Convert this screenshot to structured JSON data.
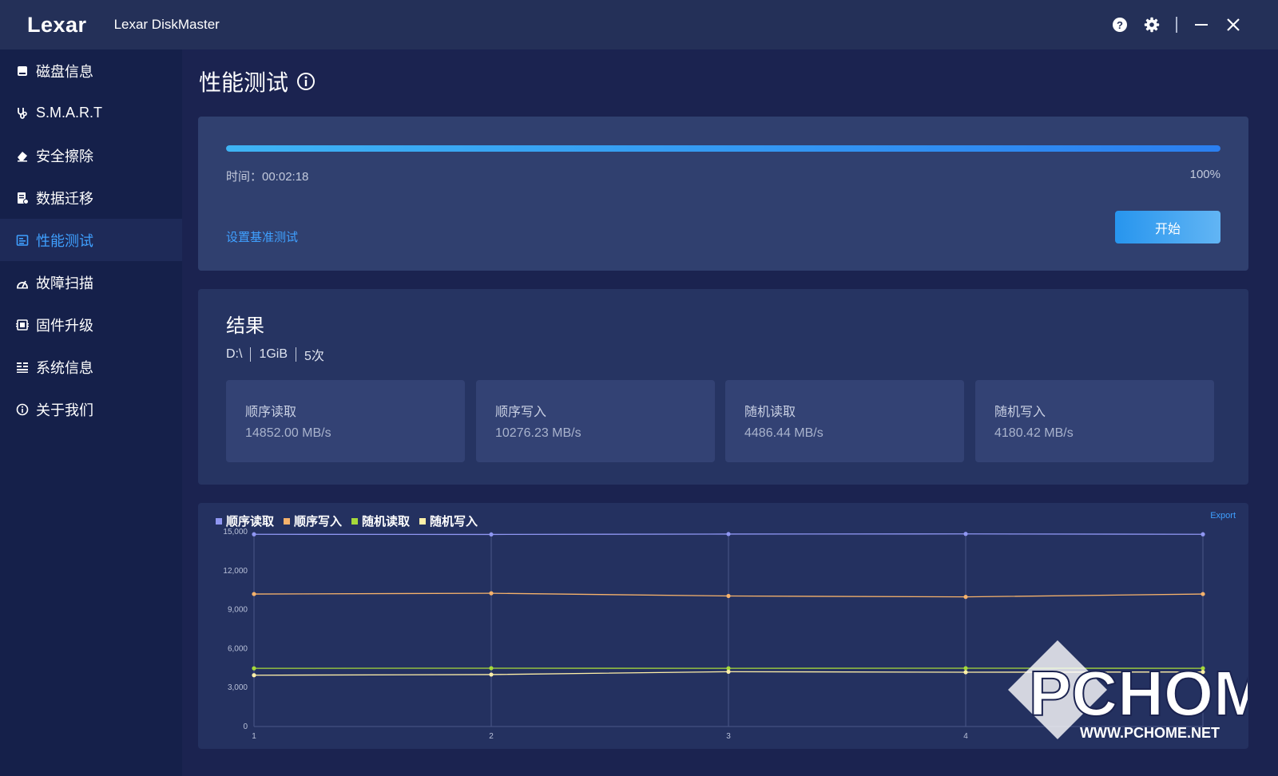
{
  "app": {
    "logo": "Lexar",
    "title": "Lexar DiskMaster"
  },
  "window_controls": [
    "help-icon",
    "gear-icon",
    "minimize-icon",
    "close-icon"
  ],
  "sidebar": {
    "items": [
      {
        "label": "磁盘信息",
        "icon": "disk-icon",
        "active": false
      },
      {
        "label": "S.M.A.R.T",
        "icon": "stethoscope-icon",
        "active": false
      },
      {
        "label": "安全擦除",
        "icon": "eraser-icon",
        "active": false
      },
      {
        "label": "数据迁移",
        "icon": "migrate-icon",
        "active": false
      },
      {
        "label": "性能测试",
        "icon": "benchmark-icon",
        "active": true
      },
      {
        "label": "故障扫描",
        "icon": "scan-icon",
        "active": false
      },
      {
        "label": "固件升级",
        "icon": "firmware-icon",
        "active": false
      },
      {
        "label": "系统信息",
        "icon": "sysinfo-icon",
        "active": false
      },
      {
        "label": "关于我们",
        "icon": "about-icon",
        "active": false
      }
    ]
  },
  "page": {
    "title": "性能测试"
  },
  "progress": {
    "time_text": "时间：00:02:18",
    "percent_text": "100%",
    "value": 1.0,
    "bench_link": "设置基准测试",
    "start_label": "开始"
  },
  "results": {
    "title": "结果",
    "drive": "D:\\",
    "size": "1GiB",
    "count": "5次",
    "stats": [
      {
        "label": "顺序读取",
        "value": "14852.00 MB/s"
      },
      {
        "label": "顺序写入",
        "value": "10276.23 MB/s"
      },
      {
        "label": "随机读取",
        "value": "4486.44 MB/s"
      },
      {
        "label": "随机写入",
        "value": "4180.42 MB/s"
      }
    ]
  },
  "chart_export": "Export",
  "colors": {
    "accent": "#3fa0ff",
    "seq_read": "#8f96f2",
    "seq_write": "#f6b26b",
    "rand_read": "#a6d93a",
    "rand_write": "#fff0a8"
  },
  "chart_data": {
    "type": "line",
    "x": [
      1,
      2,
      3,
      4,
      5
    ],
    "x_tick_labels": [
      "1",
      "2",
      "3",
      "4",
      ""
    ],
    "ylim": [
      0,
      15000
    ],
    "y_ticks": [
      0,
      3000,
      6000,
      9000,
      12000,
      15000
    ],
    "y_tick_labels": [
      "0",
      "3,000",
      "6,000",
      "9,000",
      "12,000",
      "15,000"
    ],
    "grid": true,
    "legend_position": "top-left",
    "series": [
      {
        "name": "顺序读取",
        "values": [
          14800,
          14790,
          14820,
          14830,
          14800
        ]
      },
      {
        "name": "顺序写入",
        "values": [
          10200,
          10260,
          10050,
          9980,
          10200
        ]
      },
      {
        "name": "随机读取",
        "values": [
          4480,
          4490,
          4480,
          4490,
          4480
        ]
      },
      {
        "name": "随机写入",
        "values": [
          3950,
          4000,
          4220,
          4180,
          4200
        ]
      }
    ]
  },
  "watermark": {
    "text": "PCHOME",
    "url": "WWW.PCHOME.NET"
  }
}
